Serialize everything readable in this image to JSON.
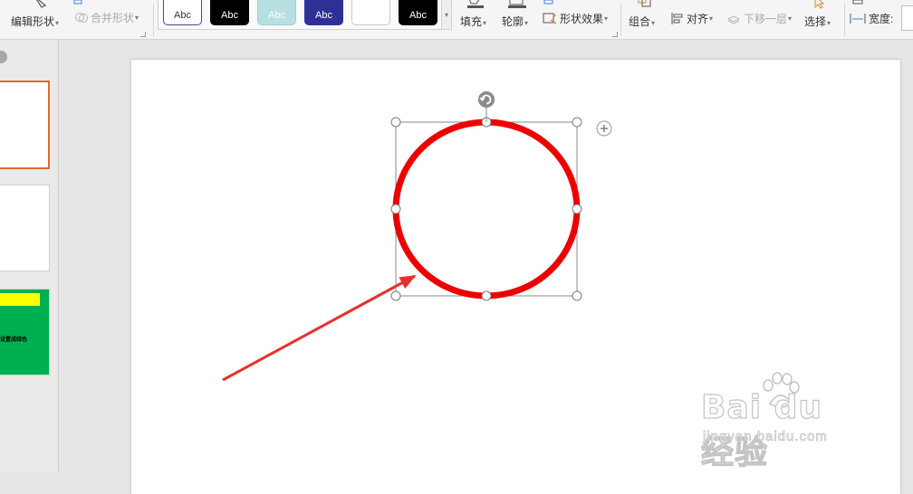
{
  "ribbon": {
    "edit_shape": "编辑形状",
    "merge_shape": "合并形状",
    "styles": [
      "Abc",
      "Abc",
      "Abc",
      "Abc",
      "",
      "Abc"
    ],
    "fill": "填充",
    "outline": "轮廓",
    "shape_effect": "形状效果",
    "group": "组合",
    "align": "对齐",
    "send_backward": "下移一层",
    "select": "选择",
    "width_label": "宽度:"
  },
  "thumbs": {
    "slide3_text": "设置成绿色"
  },
  "colors": {
    "circle": "#ee0000",
    "arrow": "#e8302a",
    "active_thumb_border": "#e26b2a",
    "slide3_bg": "#00b050",
    "slide3_bar": "#ffff00"
  },
  "icons": [
    "edit-shape-icon",
    "merge-shape-icon",
    "fill-icon",
    "outline-icon",
    "shape-effect-icon",
    "group-icon",
    "align-icon",
    "send-backward-icon",
    "select-icon",
    "width-icon",
    "rotate-handle-icon",
    "layout-options-icon"
  ],
  "watermark": {
    "brand": "Bai du 经验",
    "url": "jingyan.baidu.com"
  }
}
